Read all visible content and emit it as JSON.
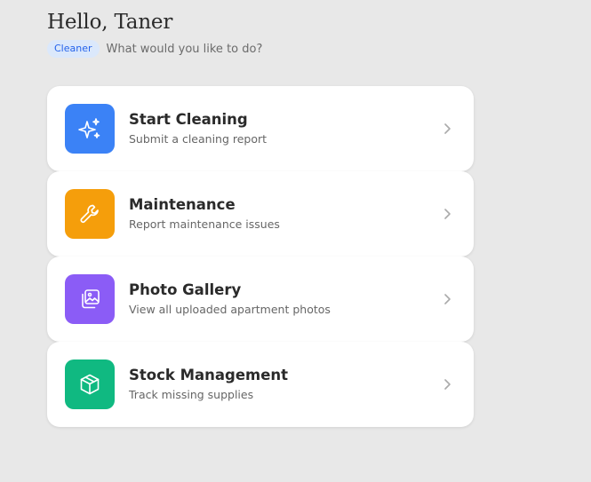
{
  "header": {
    "greeting": "Hello, Taner",
    "role_badge": "Cleaner",
    "prompt": "What would you like to do?"
  },
  "menu": {
    "items": [
      {
        "title": "Start Cleaning",
        "subtitle": "Submit a cleaning report",
        "icon": "sparkles-icon",
        "color": "#3b82f6"
      },
      {
        "title": "Maintenance",
        "subtitle": "Report maintenance issues",
        "icon": "wrench-icon",
        "color": "#f59e0b"
      },
      {
        "title": "Photo Gallery",
        "subtitle": "View all uploaded apartment photos",
        "icon": "gallery-icon",
        "color": "#8b5cf6"
      },
      {
        "title": "Stock Management",
        "subtitle": "Track missing supplies",
        "icon": "package-icon",
        "color": "#10b981"
      }
    ]
  }
}
